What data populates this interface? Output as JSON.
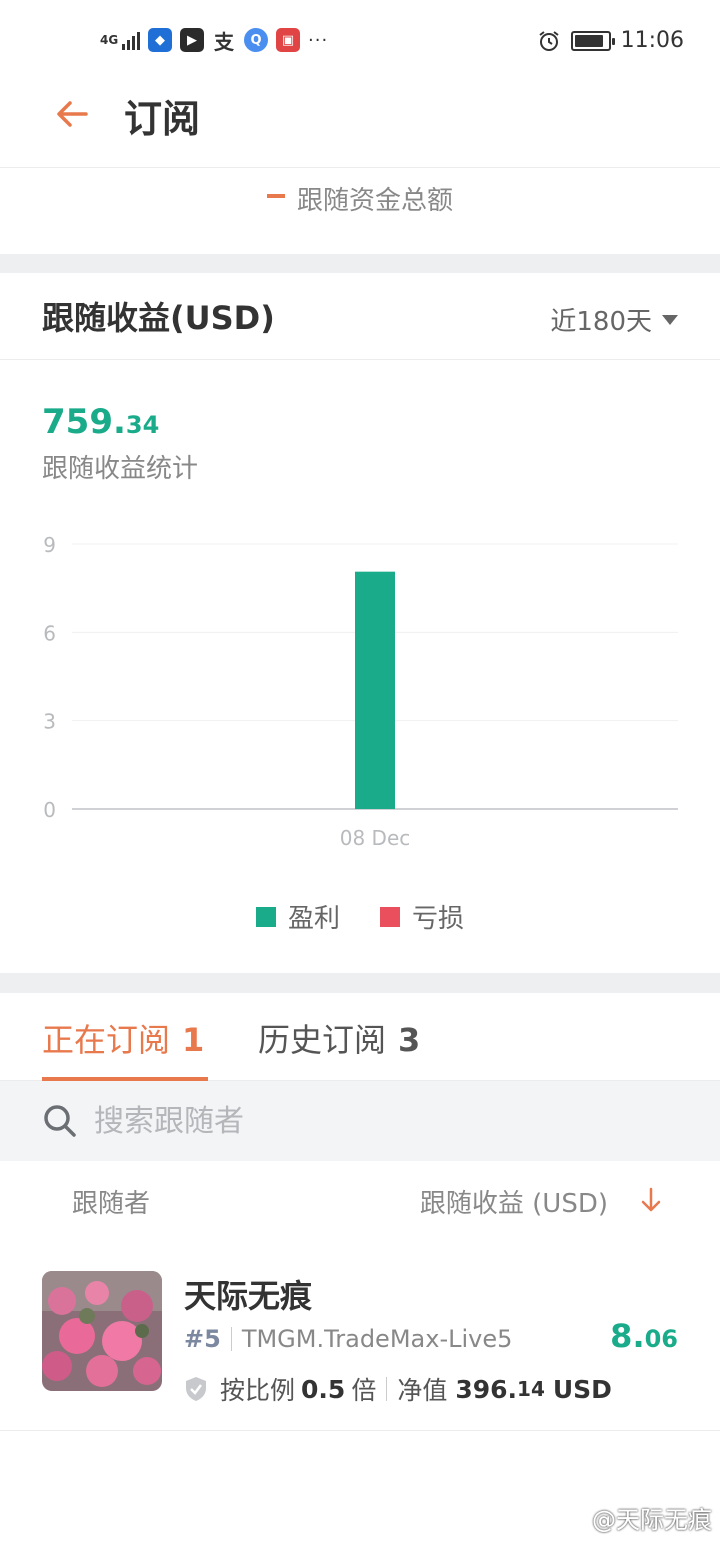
{
  "status_bar": {
    "network": "4G",
    "app_icons": [
      {
        "name": "shield-app-icon",
        "glyph": "◆",
        "color": "#1f6fd6"
      },
      {
        "name": "video-app-icon",
        "glyph": "▶",
        "color": "#2b2b2b"
      },
      {
        "name": "alipay-app-icon",
        "glyph": "支",
        "color": "#333333"
      },
      {
        "name": "browser-app-icon",
        "glyph": "Q",
        "color": "#4a8ef0"
      },
      {
        "name": "huawei-app-icon",
        "glyph": "▣",
        "color": "#e04444"
      }
    ],
    "more": "···",
    "time": "11:06"
  },
  "header": {
    "title": "订阅"
  },
  "prev_chart": {
    "legend_label": "跟随资金总额"
  },
  "profit_card": {
    "title": "跟随收益(USD)",
    "period": "近180天",
    "total_int": "759.",
    "total_dec": "34",
    "total_label": "跟随收益统计"
  },
  "chart_data": {
    "type": "bar",
    "categories": [
      "08 Dec"
    ],
    "series": [
      {
        "name": "盈利",
        "values": [
          8.06
        ],
        "color": "#1aab8a"
      },
      {
        "name": "亏损",
        "values": [
          0
        ],
        "color": "#e94f5d"
      }
    ],
    "y_ticks": [
      "9",
      "6",
      "3",
      "0"
    ],
    "ylim": [
      0,
      9
    ],
    "grid": true,
    "legend_position": "bottom"
  },
  "tabs": [
    {
      "label": "正在订阅",
      "count": "1",
      "active": true
    },
    {
      "label": "历史订阅",
      "count": "3",
      "active": false
    }
  ],
  "search": {
    "placeholder": "搜索跟随者"
  },
  "list_header": {
    "left": "跟随者",
    "right": "跟随收益 (USD)"
  },
  "followers": [
    {
      "name": "天际无痕",
      "rank": "#5",
      "account": "TMGM.TradeMax-Live5",
      "ratio_label": "按比例",
      "ratio_value": "0.5",
      "ratio_unit": "倍",
      "equity_label": "净值",
      "equity_int": "396.",
      "equity_dec": "14",
      "equity_unit": "USD",
      "profit_int": "8.",
      "profit_dec": "06"
    }
  ],
  "watermark": "@天际无痕",
  "colors": {
    "accent": "#e8794d",
    "profit": "#1aab8a",
    "loss": "#e94f5d"
  }
}
